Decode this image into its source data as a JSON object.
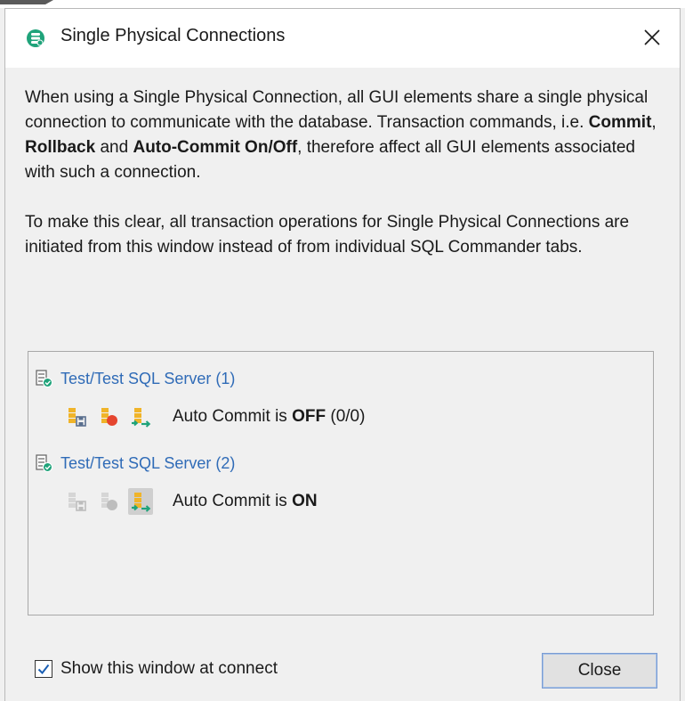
{
  "window": {
    "title": "Single Physical Connections",
    "app_icon": "app-logo-icon",
    "close_icon": "close-icon"
  },
  "description": {
    "para1": [
      {
        "text": "When using a Single Physical Connection, all GUI elements share a single physical connection to communicate with the database. Transaction commands, i.e. ",
        "bold": false
      },
      {
        "text": "Commit",
        "bold": true
      },
      {
        "text": ", ",
        "bold": false
      },
      {
        "text": "Rollback",
        "bold": true
      },
      {
        "text": " and ",
        "bold": false
      },
      {
        "text": "Auto-Commit On/Off",
        "bold": true
      },
      {
        "text": ", therefore affect all GUI elements associated with such a connection.",
        "bold": false
      }
    ],
    "para2": "To make this clear, all transaction operations for Single Physical Connections are initiated from this window instead of from individual SQL Commander tabs."
  },
  "connections": [
    {
      "label": "Test/Test SQL Server (1)",
      "icon": "database-connected-icon",
      "buttons_enabled": true,
      "status_prefix": "Auto Commit is ",
      "status_value": "OFF",
      "status_suffix": " (0/0)"
    },
    {
      "label": "Test/Test SQL Server (2)",
      "icon": "database-connected-icon",
      "buttons_enabled": false,
      "status_prefix": "Auto Commit is ",
      "status_value": "ON",
      "status_suffix": ""
    }
  ],
  "footer": {
    "show_at_connect_label": "Show this window at connect",
    "show_at_connect_checked": true,
    "close_label": "Close"
  },
  "colors": {
    "link_blue": "#2f6bb7",
    "accent_green": "#1fa37a",
    "commit_orange": "#f0b429",
    "rollback_red": "#e5452f"
  }
}
